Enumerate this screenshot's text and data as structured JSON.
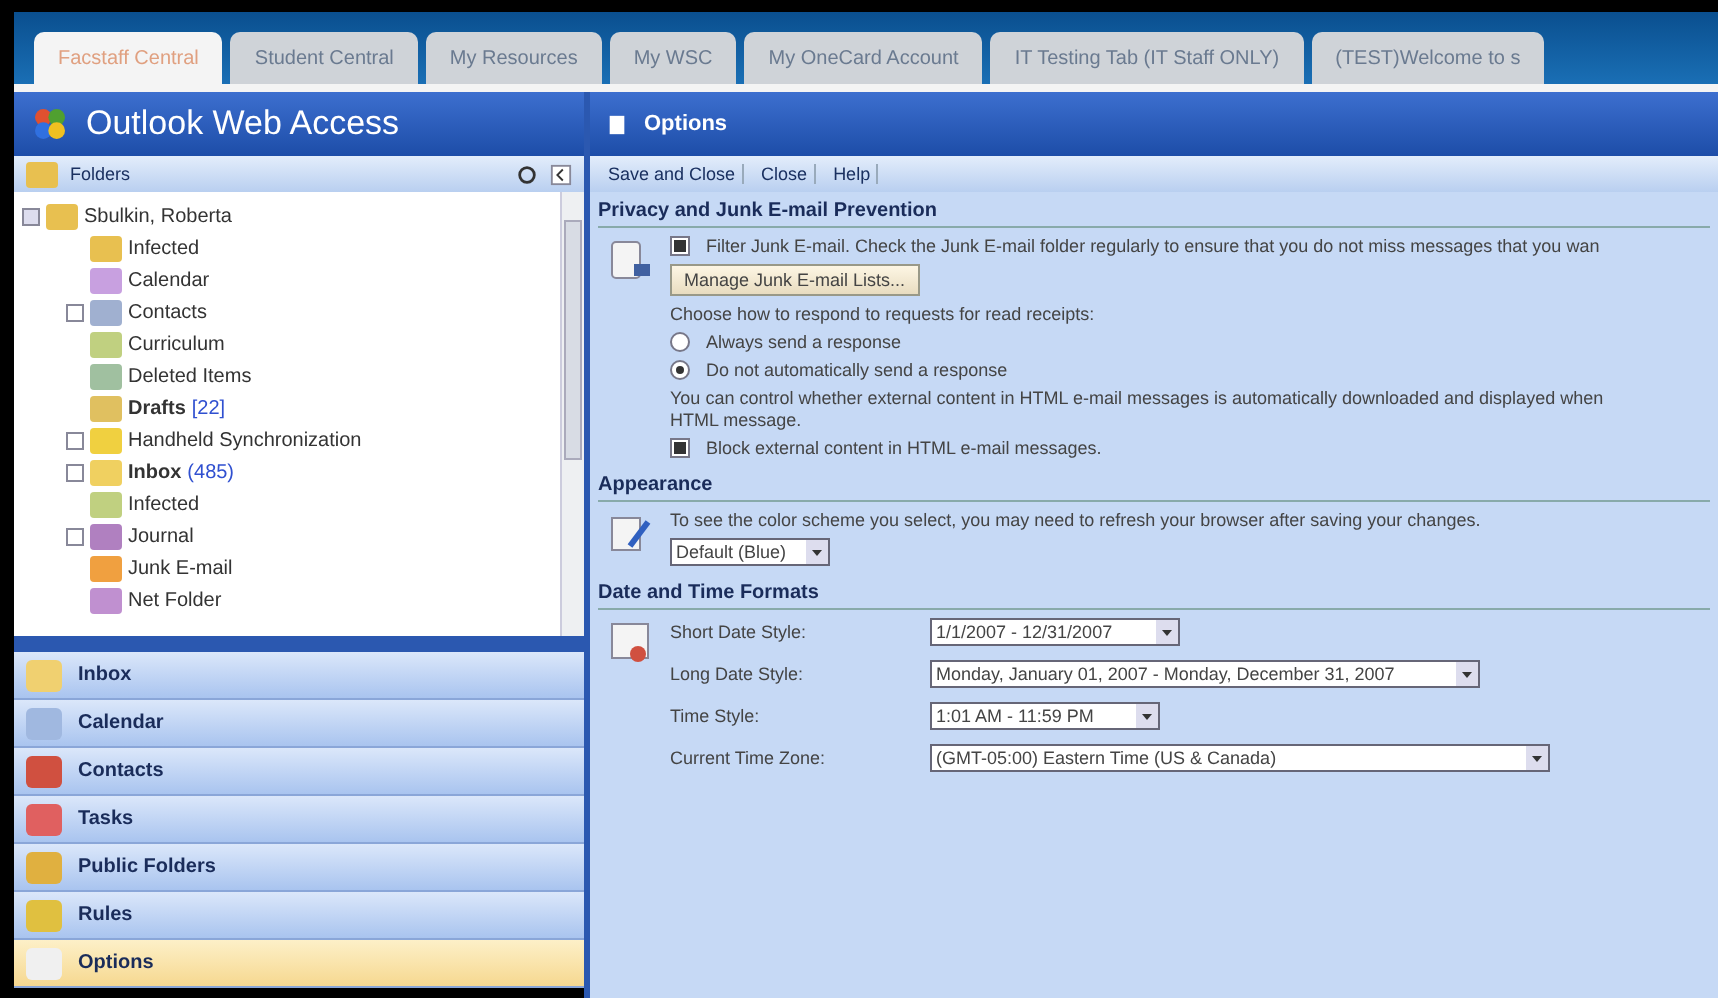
{
  "portal_tabs": [
    {
      "label": "Facstaff Central",
      "selected": true
    },
    {
      "label": "Student Central",
      "selected": false
    },
    {
      "label": "My Resources",
      "selected": false
    },
    {
      "label": "My WSC",
      "selected": false
    },
    {
      "label": "My OneCard Account",
      "selected": false
    },
    {
      "label": "IT Testing Tab (IT Staff ONLY)",
      "selected": false
    },
    {
      "label": "(TEST)Welcome to s",
      "selected": false
    }
  ],
  "app_title": "Outlook Web Access",
  "folders": {
    "title": "Folders",
    "tree": [
      {
        "name": "Sbulkin, Roberta",
        "expanded": true,
        "children": [
          {
            "name": "Infected"
          },
          {
            "name": "Calendar"
          },
          {
            "name": "Contacts",
            "expanded": false
          },
          {
            "name": "Curriculum"
          },
          {
            "name": "Deleted Items"
          },
          {
            "name": "Drafts",
            "count": "[22]",
            "unread": true
          },
          {
            "name": "Handheld Synchronization",
            "expanded": false
          },
          {
            "name": "Inbox",
            "count": "(485)",
            "unread": true,
            "expanded": false
          },
          {
            "name": "Infected"
          },
          {
            "name": "Journal",
            "expanded": false
          },
          {
            "name": "Junk E-mail"
          },
          {
            "name": "Net Folder"
          }
        ]
      }
    ]
  },
  "nav_buttons": [
    {
      "label": "Inbox",
      "selected": false
    },
    {
      "label": "Calendar",
      "selected": false
    },
    {
      "label": "Contacts",
      "selected": false
    },
    {
      "label": "Tasks",
      "selected": false
    },
    {
      "label": "Public Folders",
      "selected": false
    },
    {
      "label": "Rules",
      "selected": false
    },
    {
      "label": "Options",
      "selected": true
    }
  ],
  "page_title": "Options",
  "toolbar": [
    "Save and Close",
    "Close",
    "Help"
  ],
  "privacy": {
    "title": "Privacy and Junk E-mail Prevention",
    "filter_junk": {
      "label": "Filter Junk E-mail. Check the Junk E-mail folder regularly to ensure that you do not miss messages that you wan",
      "checked": true
    },
    "manage_button": "Manage Junk E-mail Lists...",
    "receipts_prompt": "Choose how to respond to requests for read receipts:",
    "receipt_options": [
      {
        "label": "Always send a response",
        "selected": false
      },
      {
        "label": "Do not automatically send a response",
        "selected": true
      }
    ],
    "external_note": [
      "You can control whether external content in HTML e-mail messages is automatically downloaded and displayed when",
      "HTML message."
    ],
    "block_external": {
      "label": "Block external content in HTML e-mail messages.",
      "checked": true
    }
  },
  "appearance": {
    "title": "Appearance",
    "note": "To see the color scheme you select, you may need to refresh your browser after saving your changes.",
    "scheme": "Default (Blue)"
  },
  "date_time": {
    "title": "Date and Time Formats",
    "rows": [
      {
        "label": "Short Date Style:",
        "value": "1/1/2007 - 12/31/2007"
      },
      {
        "label": "Long Date Style:",
        "value": "Monday, January 01, 2007 - Monday, December 31, 2007"
      },
      {
        "label": "Time Style:",
        "value": "1:01 AM - 11:59 PM"
      },
      {
        "label": "Current Time Zone:",
        "value": "(GMT-05:00) Eastern Time (US & Canada)"
      }
    ]
  }
}
